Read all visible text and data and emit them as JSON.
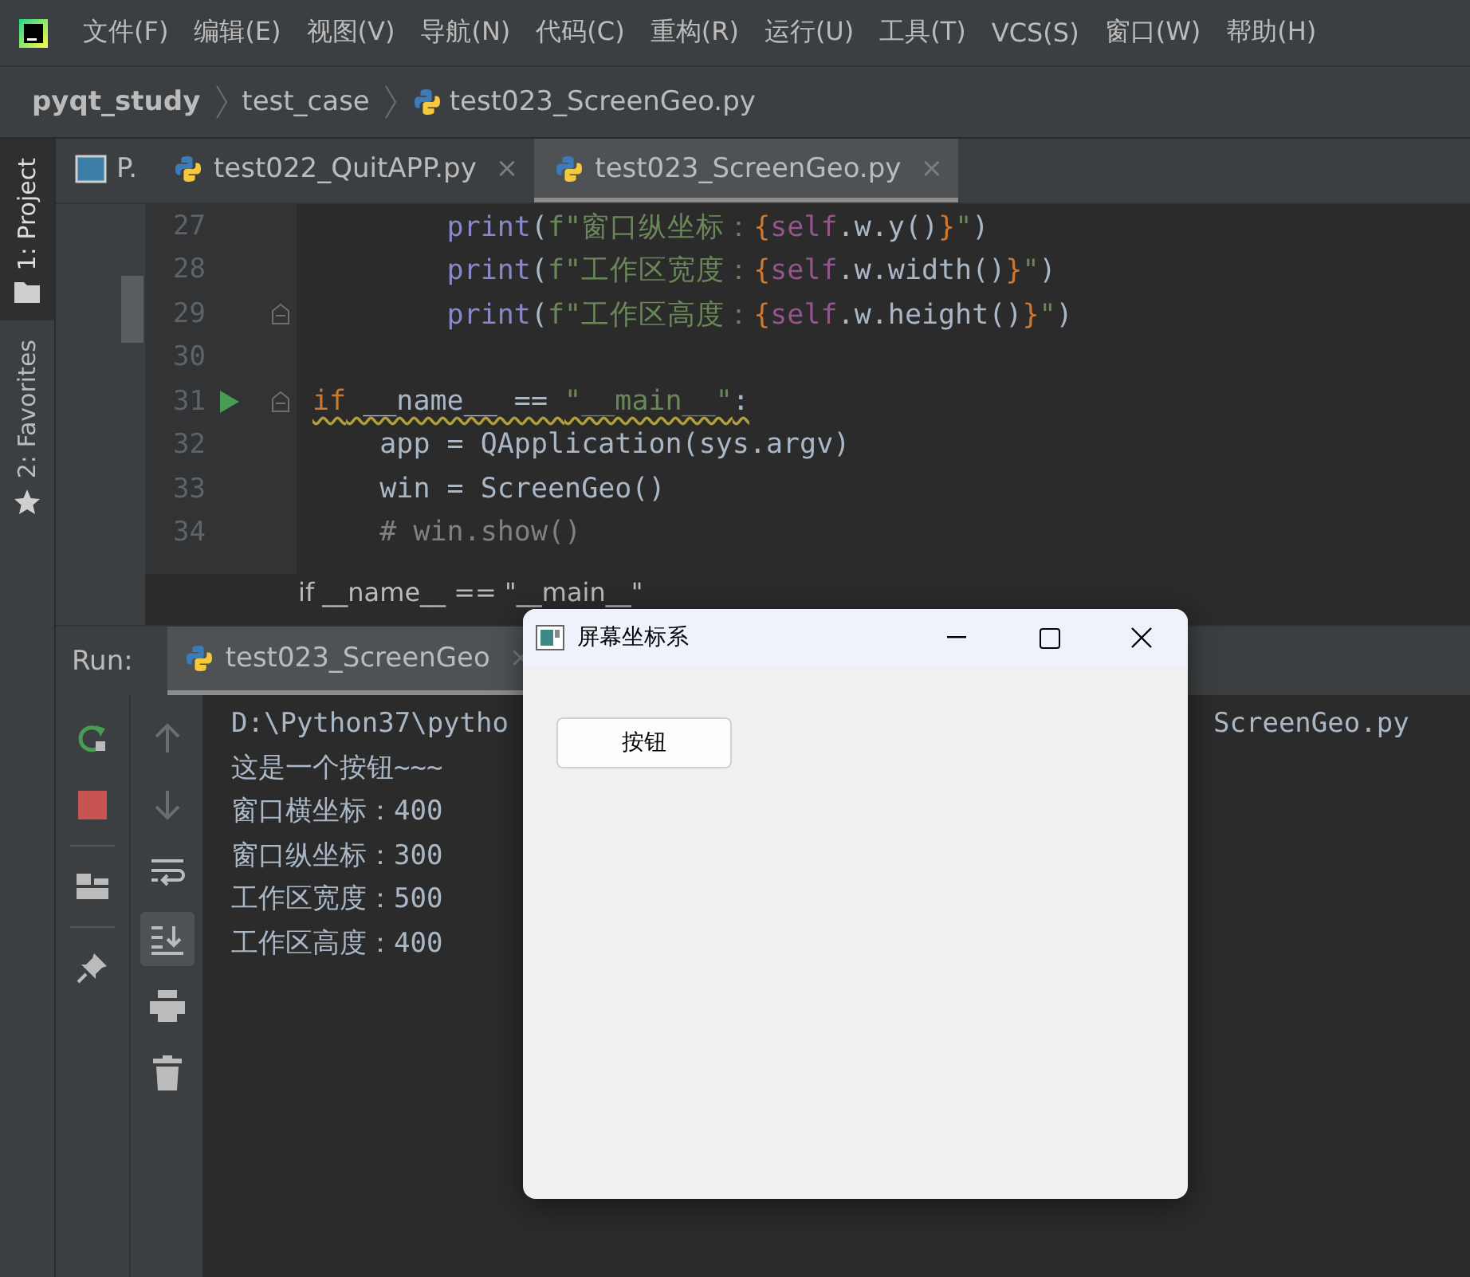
{
  "menu_bar": {
    "items": [
      "文件(F)",
      "编辑(E)",
      "视图(V)",
      "导航(N)",
      "代码(C)",
      "重构(R)",
      "运行(U)",
      "工具(T)",
      "VCS(S)",
      "窗口(W)",
      "帮助(H)"
    ]
  },
  "breadcrumbs": [
    "pyqt_study",
    "test_case",
    "test023_ScreenGeo.py"
  ],
  "tool_strip": [
    {
      "label": "1: Project",
      "selected": true,
      "kind": "folder"
    },
    {
      "label": "2: Favorites",
      "selected": false,
      "kind": "star"
    }
  ],
  "editor_tabs": [
    {
      "label": "P.",
      "kind": "panel",
      "selected": false
    },
    {
      "label": "test022_QuitAPP.py",
      "kind": "python",
      "selected": false,
      "close": "×"
    },
    {
      "label": "test023_ScreenGeo.py",
      "kind": "python",
      "selected": true,
      "close": "×"
    }
  ],
  "code_lines": [
    {
      "number": "27",
      "tokens": [
        {
          "text": "        print",
          "kind": "fn"
        },
        {
          "text": "(",
          "kind": "plain"
        },
        {
          "text": "f\"窗口纵坐标：",
          "kind": "str"
        },
        {
          "text": "{",
          "kind": "brace"
        },
        {
          "text": "self",
          "kind": "self"
        },
        {
          "text": ".w.y()",
          "kind": "plain"
        },
        {
          "text": "}",
          "kind": "brace"
        },
        {
          "text": "\"",
          "kind": "str"
        },
        {
          "text": ")",
          "kind": "plain"
        }
      ]
    },
    {
      "number": "28",
      "tokens": [
        {
          "text": "        print",
          "kind": "fn"
        },
        {
          "text": "(",
          "kind": "plain"
        },
        {
          "text": "f\"工作区宽度：",
          "kind": "str"
        },
        {
          "text": "{",
          "kind": "brace"
        },
        {
          "text": "self",
          "kind": "self"
        },
        {
          "text": ".w.width()",
          "kind": "plain"
        },
        {
          "text": "}",
          "kind": "brace"
        },
        {
          "text": "\"",
          "kind": "str"
        },
        {
          "text": ")",
          "kind": "plain"
        }
      ]
    },
    {
      "number": "29",
      "fold": true,
      "tokens": [
        {
          "text": "        print",
          "kind": "fn"
        },
        {
          "text": "(",
          "kind": "plain"
        },
        {
          "text": "f\"工作区高度：",
          "kind": "str"
        },
        {
          "text": "{",
          "kind": "brace"
        },
        {
          "text": "self",
          "kind": "self"
        },
        {
          "text": ".w.height()",
          "kind": "plain"
        },
        {
          "text": "}",
          "kind": "brace"
        },
        {
          "text": "\"",
          "kind": "str"
        },
        {
          "text": ")",
          "kind": "plain"
        }
      ]
    },
    {
      "number": "30"
    },
    {
      "number": "31",
      "fold": true,
      "run": true,
      "warning": true,
      "tokens": [
        {
          "text": "if",
          "kind": "kw"
        },
        {
          "text": " __name__ == ",
          "kind": "plain"
        },
        {
          "text": "\"__main__\"",
          "kind": "str"
        },
        {
          "text": ":",
          "kind": "plain"
        }
      ]
    },
    {
      "number": "32",
      "tokens": [
        {
          "text": "    app = QApplication(sys.argv)",
          "kind": "plain"
        }
      ]
    },
    {
      "number": "33",
      "tokens": [
        {
          "text": "    win = ScreenGeo()",
          "kind": "plain"
        }
      ]
    },
    {
      "number": "34",
      "tokens": [
        {
          "text": "    # win.show()",
          "kind": "comment"
        }
      ]
    }
  ],
  "code_breadcrumb": "if __name__ == \"__main__\"",
  "run_panel": {
    "label": "Run:",
    "tab": "test023_ScreenGeo",
    "close": "×",
    "console": [
      {
        "parts": [
          "D:\\Python37\\pytho",
          "ScreenGeo.py"
        ]
      },
      {
        "parts": [
          "这是一个按钮~~~"
        ]
      },
      {
        "parts": [
          "窗口横坐标：400"
        ]
      },
      {
        "parts": [
          "窗口纵坐标：300"
        ]
      },
      {
        "parts": [
          "工作区宽度：500"
        ]
      },
      {
        "parts": [
          "工作区高度：400"
        ]
      }
    ]
  },
  "dialog": {
    "title": "屏幕坐标系",
    "button": "按钮"
  }
}
